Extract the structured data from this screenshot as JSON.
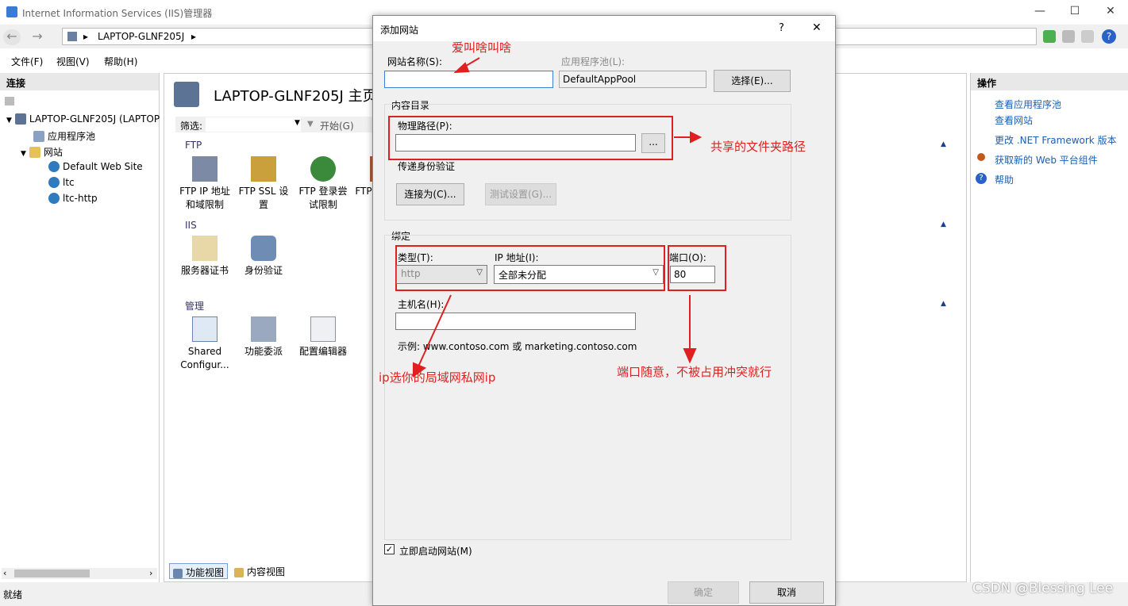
{
  "window": {
    "title": "Internet Information Services (IIS)管理器",
    "controls": [
      "—",
      "☐",
      "✕"
    ]
  },
  "address": {
    "crumb": "LAPTOP-GLNF205J",
    "separator": "▸"
  },
  "menu": {
    "items": [
      "文件(F)",
      "视图(V)",
      "帮助(H)"
    ]
  },
  "left_panel": {
    "header": "连接",
    "tree": [
      {
        "label": "LAPTOP-GLNF205J (LAPTOP",
        "icon": "server-icon",
        "indent": 0
      },
      {
        "label": "应用程序池",
        "icon": "app-pool-icon",
        "indent": 1
      },
      {
        "label": "网站",
        "icon": "sites-folder-icon",
        "indent": 1
      },
      {
        "label": "Default Web Site",
        "icon": "globe-icon",
        "indent": 2
      },
      {
        "label": "ltc",
        "icon": "globe-icon",
        "indent": 2
      },
      {
        "label": "ltc-http",
        "icon": "globe-icon",
        "indent": 2
      }
    ]
  },
  "center": {
    "heading": "LAPTOP-GLNF205J 主页",
    "filter_label": "筛选:",
    "go_label": "开始(G)",
    "groups": [
      {
        "name": "FTP",
        "features": [
          "FTP IP 地址和域限制",
          "FTP SSL 设置",
          "FTP 登录尝试限制",
          "FTP"
        ]
      },
      {
        "name": "IIS",
        "features": [
          "服务器证书",
          "身份验证"
        ]
      },
      {
        "name": "管理",
        "features": [
          "Shared Configur...",
          "功能委派",
          "配置编辑器"
        ]
      }
    ],
    "view_tabs": [
      "功能视图",
      "内容视图"
    ]
  },
  "right_panel": {
    "header": "操作",
    "actions": [
      "查看应用程序池",
      "查看网站",
      "更改 .NET Framework 版本",
      "获取新的 Web 平台组件",
      "帮助"
    ]
  },
  "status": "就绪",
  "dialog": {
    "title": "添加网站",
    "help": "?",
    "close": "✕",
    "site_name_label": "网站名称(S):",
    "site_name_value": "",
    "app_pool_label": "应用程序池(L):",
    "app_pool_value": "DefaultAppPool",
    "select_button": "选择(E)...",
    "content_dir_label": "内容目录",
    "physical_path_label": "物理路径(P):",
    "physical_path_value": "",
    "browse_button": "...",
    "passthrough_label": "传递身份验证",
    "connect_as_button": "连接为(C)...",
    "test_settings_button": "测试设置(G)...",
    "binding_label": "绑定",
    "type_label": "类型(T):",
    "type_value": "http",
    "ip_label": "IP 地址(I):",
    "ip_value": "全部未分配",
    "port_label": "端口(O):",
    "port_value": "80",
    "hostname_label": "主机名(H):",
    "hostname_value": "",
    "example_text": "示例: www.contoso.com 或 marketing.contoso.com",
    "start_checkbox_label": "立即启动网站(M)",
    "start_checked": true,
    "ok_button": "确定",
    "cancel_button": "取消"
  },
  "annotations": {
    "name": "爱叫啥叫啥",
    "path": "共享的文件夹路径",
    "ip": "ip选你的局域网私网ip",
    "port": "端口随意，不被占用冲突就行"
  },
  "watermark": "CSDN @Blessing Lee",
  "colors": {
    "annotation": "#e02020",
    "link": "#1a5fb4",
    "dialog_bg": "#f0f0f0"
  }
}
